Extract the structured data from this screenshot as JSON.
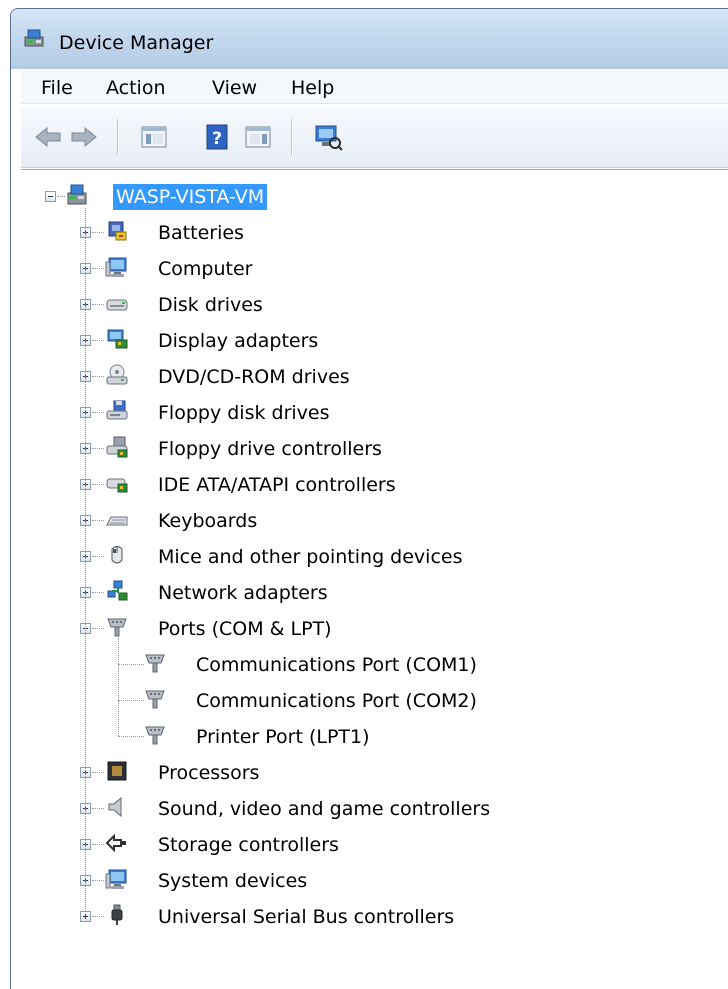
{
  "window": {
    "title": "Device Manager",
    "title_icon": "device-manager-icon"
  },
  "menu": {
    "items": [
      "File",
      "Action",
      "View",
      "Help"
    ]
  },
  "toolbar": {
    "buttons": [
      {
        "name": "back-button",
        "icon": "back-arrow-icon"
      },
      {
        "name": "forward-button",
        "icon": "forward-arrow-icon"
      },
      {
        "name": "show-hide-console-tree-button",
        "icon": "console-tree-icon"
      },
      {
        "name": "help-button",
        "icon": "help-icon"
      },
      {
        "name": "show-hide-action-pane-button",
        "icon": "action-pane-icon"
      },
      {
        "name": "scan-hardware-button",
        "icon": "scan-hardware-icon"
      }
    ]
  },
  "tree": {
    "root": {
      "label": "WASP-VISTA-VM",
      "icon": "computer-network-icon",
      "selected": true
    },
    "categories": [
      {
        "label": "Batteries",
        "icon": "battery-icon",
        "expanded": false
      },
      {
        "label": "Computer",
        "icon": "computer-icon",
        "expanded": false
      },
      {
        "label": "Disk drives",
        "icon": "disk-drive-icon",
        "expanded": false
      },
      {
        "label": "Display adapters",
        "icon": "display-adapter-icon",
        "expanded": false
      },
      {
        "label": "DVD/CD-ROM drives",
        "icon": "dvd-drive-icon",
        "expanded": false
      },
      {
        "label": "Floppy disk drives",
        "icon": "floppy-drive-icon",
        "expanded": false
      },
      {
        "label": "Floppy drive controllers",
        "icon": "floppy-controller-icon",
        "expanded": false
      },
      {
        "label": "IDE ATA/ATAPI controllers",
        "icon": "ide-controller-icon",
        "expanded": false
      },
      {
        "label": "Keyboards",
        "icon": "keyboard-icon",
        "expanded": false
      },
      {
        "label": "Mice and other pointing devices",
        "icon": "mouse-icon",
        "expanded": false
      },
      {
        "label": "Network adapters",
        "icon": "network-adapter-icon",
        "expanded": false
      },
      {
        "label": "Ports (COM & LPT)",
        "icon": "port-icon",
        "expanded": true,
        "children": [
          {
            "label": "Communications Port (COM1)",
            "icon": "port-icon"
          },
          {
            "label": "Communications Port (COM2)",
            "icon": "port-icon"
          },
          {
            "label": "Printer Port (LPT1)",
            "icon": "port-icon"
          }
        ]
      },
      {
        "label": "Processors",
        "icon": "processor-icon",
        "expanded": false
      },
      {
        "label": "Sound, video and game controllers",
        "icon": "speaker-icon",
        "expanded": false
      },
      {
        "label": "Storage controllers",
        "icon": "storage-controller-icon",
        "expanded": false
      },
      {
        "label": "System devices",
        "icon": "system-device-icon",
        "expanded": false
      },
      {
        "label": "Universal Serial Bus controllers",
        "icon": "usb-icon",
        "expanded": false
      }
    ]
  },
  "colors": {
    "selection": "#3399ff",
    "titlebar": "#c3d8ee",
    "tree_lines": "#9a9a9a"
  }
}
